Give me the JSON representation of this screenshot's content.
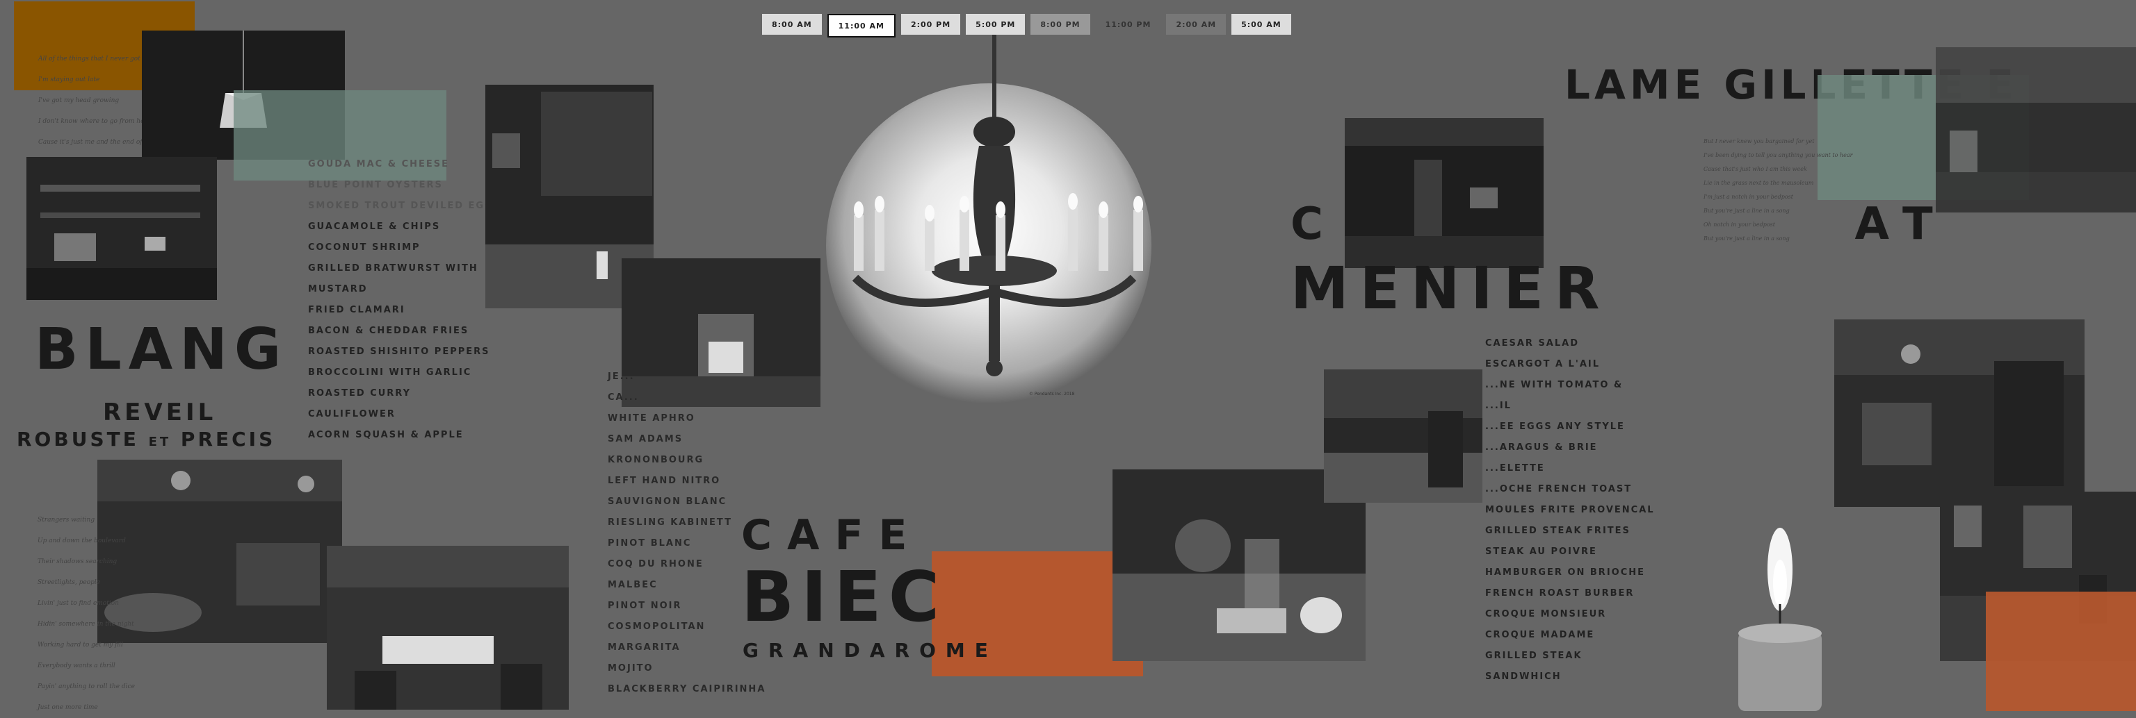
{
  "time_buttons": [
    "8:00 AM",
    "11:00 AM",
    "2:00 PM",
    "5:00 PM",
    "8:00 PM",
    "11:00 PM",
    "2:00 AM",
    "5:00 AM"
  ],
  "active_time": "11:00 AM",
  "left_menu": [
    "GOUDA MAC & CHEESE",
    "BLUE POINT OYSTERS",
    "SMOKED TROUT DEVILED EGGS",
    "GUACAMOLE & CHIPS",
    "COCONUT SHRIMP",
    "GRILLED BRATWURST WITH",
    "MUSTARD",
    "FRIED CLAMARI",
    "BACON & CHEDDAR FRIES",
    "ROASTED SHISHITO PEPPERS",
    "BROCCOLINI WITH GARLIC",
    "ROASTED CURRY",
    "CAULIFLOWER",
    "ACORN SQUASH & APPLE"
  ],
  "drinks_menu": [
    "JE...",
    "CA...",
    "WHITE APHRO",
    "SAM ADAMS",
    "KRONONBOURG",
    "LEFT HAND NITRO",
    "SAUVIGNON BLANC",
    "RIESLING KABINETT",
    "PINOT BLANC",
    "COQ DU RHONE",
    "MALBEC",
    "PINOT NOIR",
    "COSMOPOLITAN",
    "MARGARITA",
    "MOJITO",
    "BLACKBERRY CAIPIRINHA"
  ],
  "right_menu": [
    "CAESAR SALAD",
    "ESCARGOT A L'AIL",
    "...NE WITH TOMATO &",
    "...IL",
    "...EE EGGS ANY STYLE",
    "...ARAGUS & BRIE",
    "...ELETTE",
    "...OCHE FRENCH TOAST",
    "MOULES FRITE PROVENCAL",
    "GRILLED STEAK FRITES",
    "STEAK AU POIVRE",
    "HAMBURGER ON BRIOCHE",
    "FRENCH ROAST BURBER",
    "CROQUE MONSIEUR",
    "CROQUE MADAME",
    "GRILLED STEAK",
    "SANDWHICH"
  ],
  "titles": {
    "blang": "BLANG",
    "reveil": "REVEIL",
    "robuste_a": "ROBUSTE",
    "robuste_et": "ET",
    "robuste_b": "PRECIS",
    "cafe": "CAFE",
    "biec": "BIEC",
    "grandarome": "GRANDAROME",
    "lame": "LAME GILLETTE E",
    "c_at": "C                AT",
    "menier": "MENIER"
  },
  "top_left_poem": [
    "All of the things that I never got to",
    "say",
    "I'm staying out late",
    "I've got my head growing",
    "I don't know where to go from here",
    "Cause it's just me and the end of the year"
  ],
  "bottom_left_poem": [
    "Strangers waiting",
    "Up and down the boulevard",
    "Their shadows searching",
    "Streetlights, people",
    "Livin' just to find emotion",
    "Hidin' somewhere in the night",
    "Working hard to get my fill",
    "Everybody wants a thrill",
    "Payin' anything to roll the dice",
    "Just one more time"
  ],
  "right_poem": [
    "But I never knew you bargained for yet",
    "I've been dying to tell you anything you want to hear",
    "Cause that's just who I am this week",
    "Lie in the grass next to the mausoleum",
    "I'm just a notch in your bedpost",
    "But you're just a line in a song",
    "Oh notch in your bedpost",
    "But you're just a line in a song"
  ],
  "chandelier_caption": "© Pendants Inc. 2018",
  "colors": {
    "background": "#666666",
    "orange": "#b5572e",
    "teal": "#6f8a80",
    "amber": "#8a5500"
  }
}
